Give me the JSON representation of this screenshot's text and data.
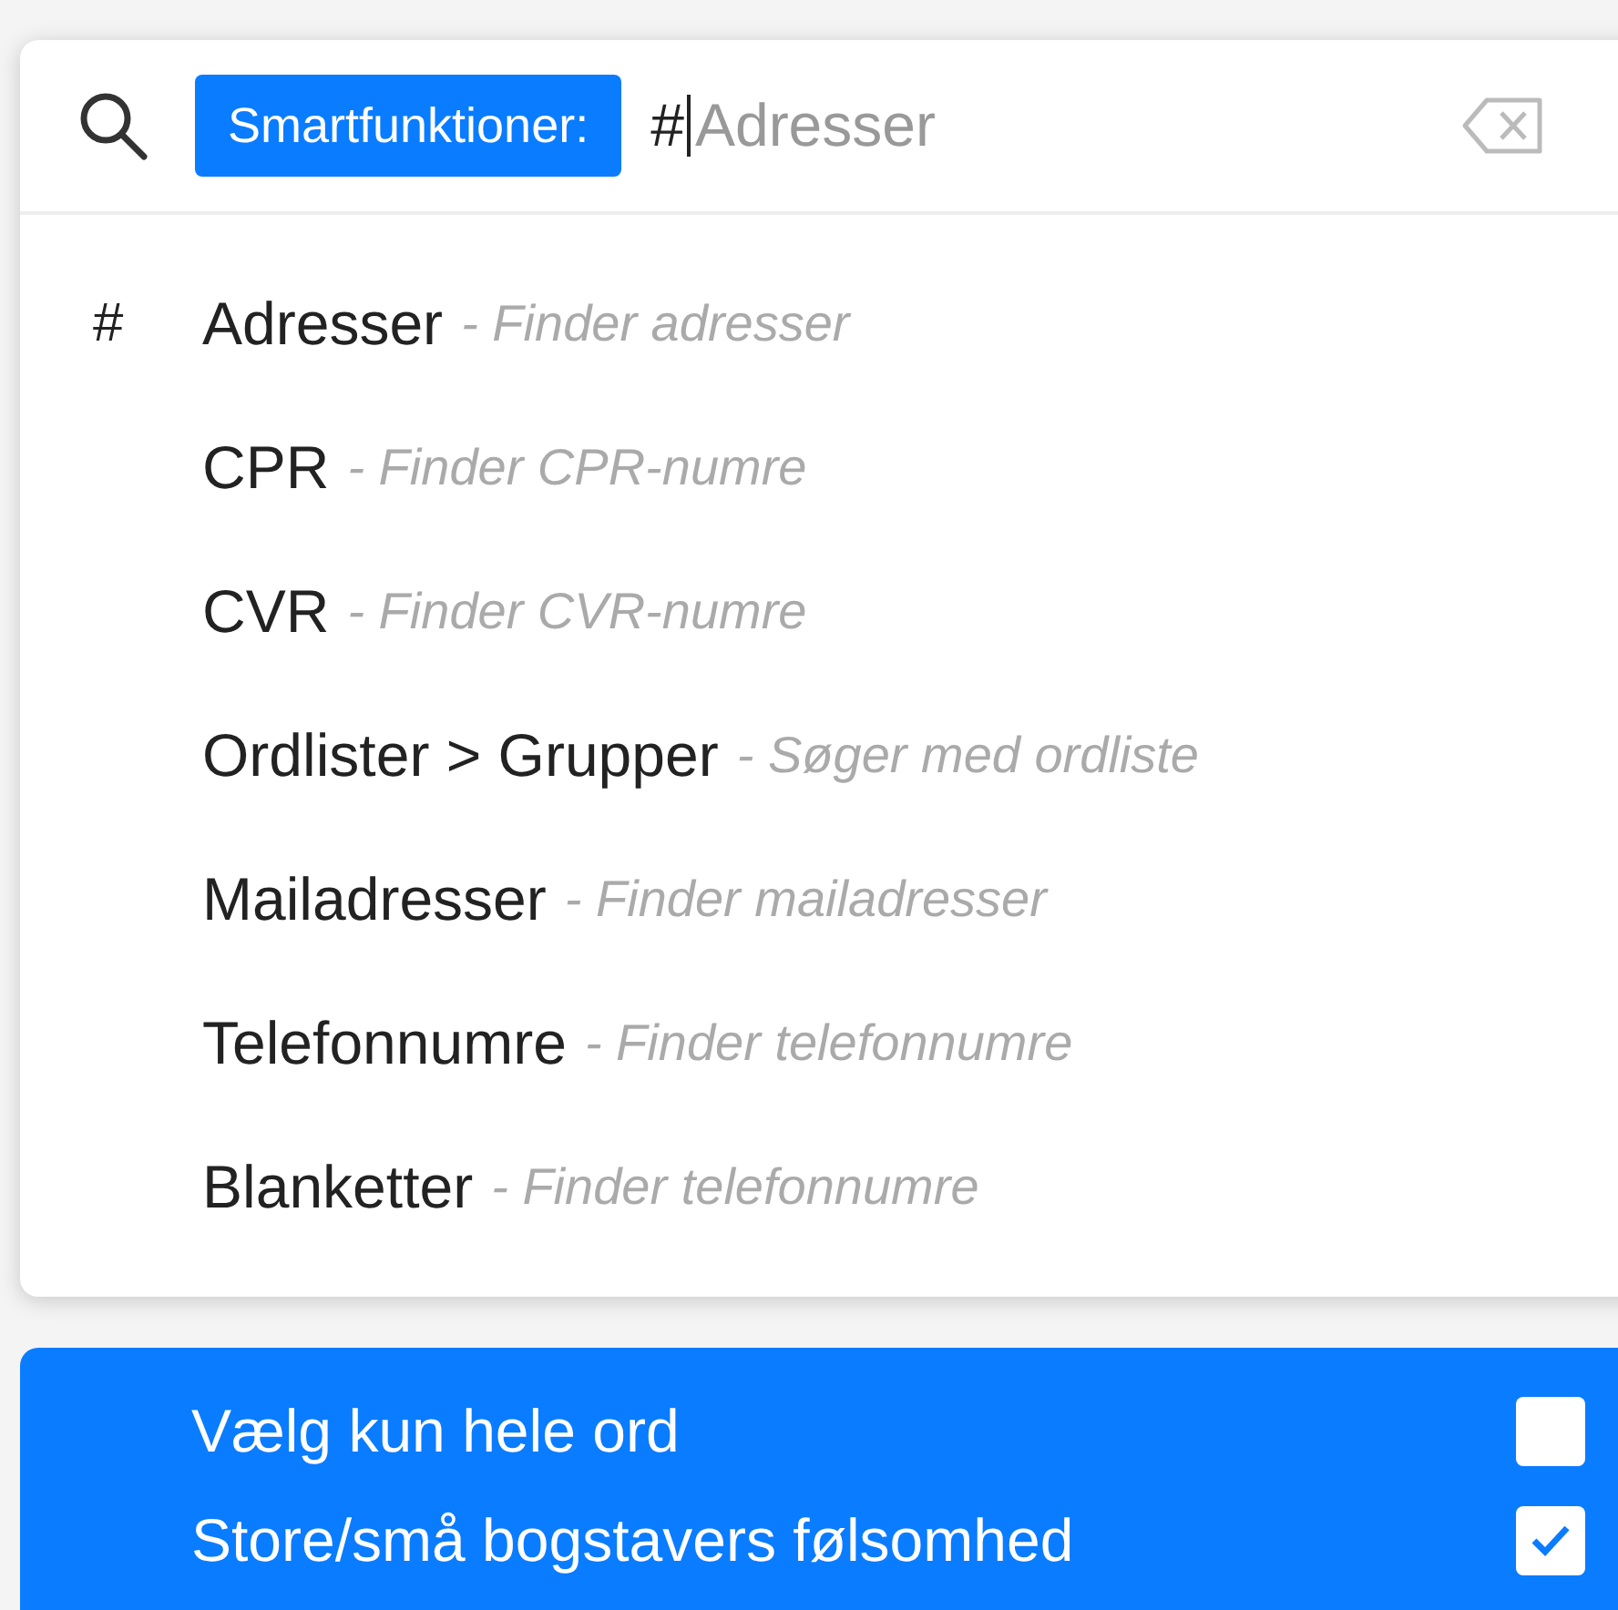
{
  "search": {
    "chip": "Smartfunktioner:",
    "value": "#",
    "completion": "Adresser"
  },
  "selection_marker": "#",
  "suggestions": [
    {
      "name": "Adresser",
      "description": "- Finder adresser",
      "selected": true
    },
    {
      "name": "CPR",
      "description": "- Finder CPR-numre",
      "selected": false
    },
    {
      "name": "CVR",
      "description": "- Finder CVR-numre",
      "selected": false
    },
    {
      "name": "Ordlister > Grupper",
      "description": "- Søger med ordliste",
      "selected": false
    },
    {
      "name": "Mailadresser",
      "description": "- Finder mailadresser",
      "selected": false
    },
    {
      "name": "Telefonnumre",
      "description": "- Finder telefonnumre",
      "selected": false
    },
    {
      "name": "Blanketter",
      "description": "- Finder telefonnumre",
      "selected": false
    }
  ],
  "options": [
    {
      "label": "Vælg kun hele ord",
      "checked": false
    },
    {
      "label": "Store/små bogstavers følsomhed",
      "checked": true
    }
  ]
}
